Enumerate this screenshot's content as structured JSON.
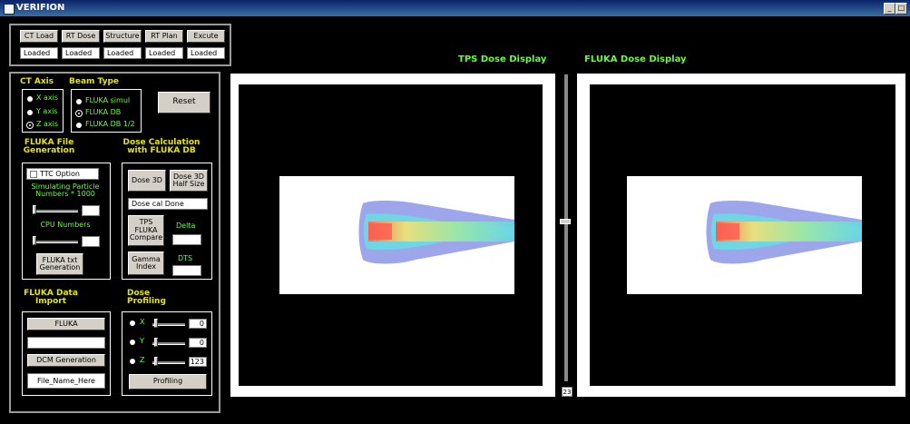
{
  "window": {
    "title": "VERIFION",
    "minimize_glyph": "_",
    "maximize_glyph": "□"
  },
  "load_buttons": [
    "CT Load",
    "RT Dose",
    "Structure",
    "RT Plan",
    "Excute"
  ],
  "load_status": [
    "Loaded",
    "Loaded",
    "Loaded",
    "Loaded",
    "Loaded"
  ],
  "ct_axis": {
    "title": "CT Axis",
    "options": [
      "X axis",
      "Y axis",
      "Z axis"
    ],
    "selected": "Z axis"
  },
  "beam_type": {
    "title": "Beam Type",
    "options": [
      "FLUKA simul",
      "FLUKA DB",
      "FLUKA DB 1/2"
    ],
    "selected": "FLUKA DB"
  },
  "reset_label": "Reset",
  "fluka_file": {
    "title_line1": "FLUKA File",
    "title_line2": "Generation",
    "ttc_option": "TTC Option",
    "sim_label_line1": "Simulating Particle",
    "sim_label_line2": "Numbers * 1000",
    "sim_value": "",
    "cpu_label": "CPU Numbers",
    "cpu_value": "",
    "gen_line1": "FLUKA txt",
    "gen_line2": "Generation"
  },
  "dose_calc": {
    "title_line1": "Dose Calculation",
    "title_line2": "with FLUKA DB",
    "dose3d": "Dose 3D",
    "half_line1": "Dose 3D",
    "half_line2": "Half Size",
    "status": "Dose cal Done",
    "compare_line1": "TPS",
    "compare_line2": "FLUKA",
    "compare_line3": "Compare",
    "delta_label": "Delta",
    "delta_value": "",
    "gamma_line1": "Gamma",
    "gamma_line2": "Index",
    "dts_label": "DTS",
    "dts_value": ""
  },
  "data_import": {
    "title_line1": "FLUKA Data",
    "title_line2": "Import",
    "fluka_btn": "FLUKA",
    "fluka_path": "",
    "dcm_btn": "DCM Generation",
    "file_name": "File_Name_Here"
  },
  "profiling": {
    "title_line1": "Dose",
    "title_line2": "Profiling",
    "axes": [
      {
        "label": "X",
        "value": "0",
        "level": 0.05
      },
      {
        "label": "Y",
        "value": "0",
        "level": 0.05
      },
      {
        "label": "Z",
        "value": "123",
        "level": 0.05
      }
    ],
    "button": "Profiling"
  },
  "tps_display": {
    "title": "TPS Dose Display"
  },
  "fluka_display": {
    "title": "FLUKA Dose Display"
  },
  "slice_slider": {
    "value": "23",
    "level": 0.48
  },
  "colors": {
    "label_yellow": "#e6e600",
    "label_green": "#66ff33",
    "dose_outer": "#8c96e6",
    "dose_core": "#ff6a4a"
  }
}
